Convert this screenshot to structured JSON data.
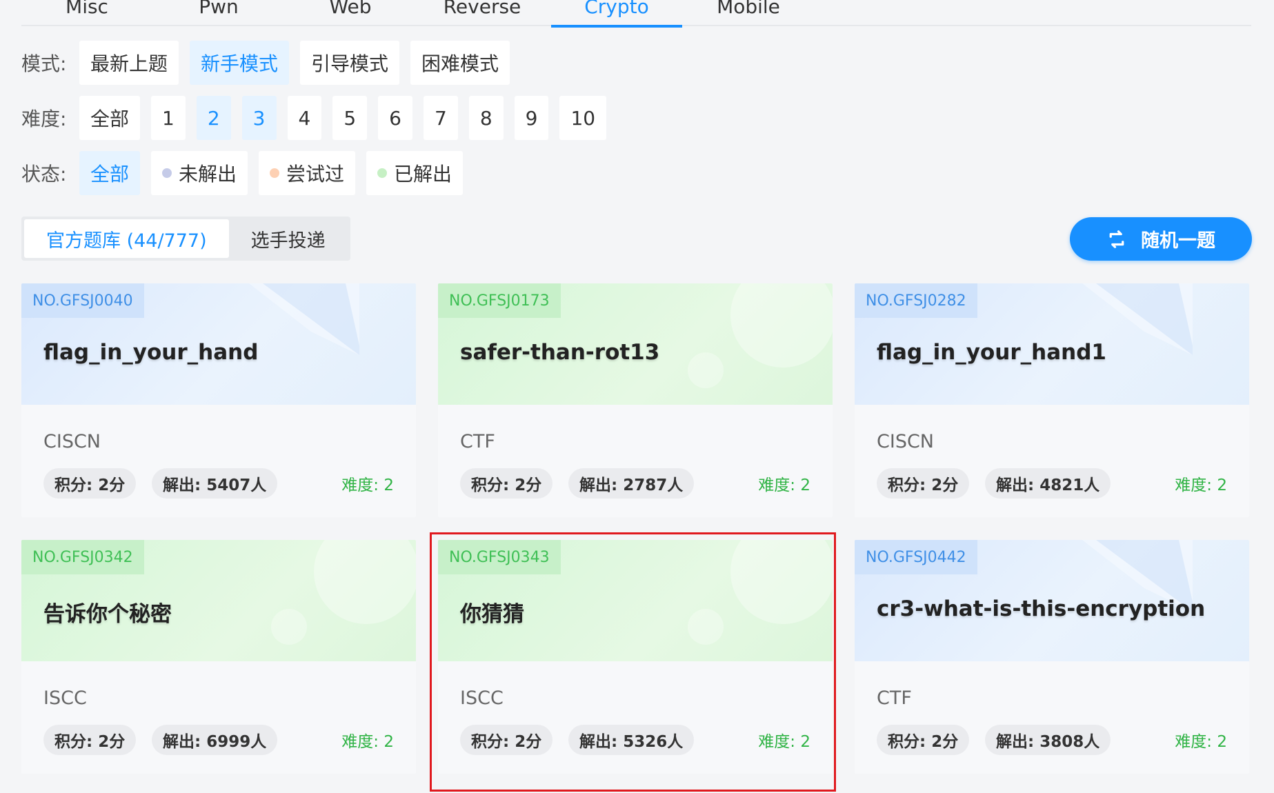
{
  "category_tabs": [
    {
      "label": "Misc",
      "active": false
    },
    {
      "label": "Pwn",
      "active": false
    },
    {
      "label": "Web",
      "active": false
    },
    {
      "label": "Reverse",
      "active": false
    },
    {
      "label": "Crypto",
      "active": true
    },
    {
      "label": "Mobile",
      "active": false
    }
  ],
  "filters": {
    "mode": {
      "label": "模式:",
      "options": [
        {
          "label": "最新上题",
          "active": false
        },
        {
          "label": "新手模式",
          "active": true
        },
        {
          "label": "引导模式",
          "active": false
        },
        {
          "label": "困难模式",
          "active": false
        }
      ]
    },
    "difficulty": {
      "label": "难度:",
      "options": [
        {
          "label": "全部",
          "active": false
        },
        {
          "label": "1",
          "active": false
        },
        {
          "label": "2",
          "active": true
        },
        {
          "label": "3",
          "active": true
        },
        {
          "label": "4",
          "active": false
        },
        {
          "label": "5",
          "active": false
        },
        {
          "label": "6",
          "active": false
        },
        {
          "label": "7",
          "active": false
        },
        {
          "label": "8",
          "active": false
        },
        {
          "label": "9",
          "active": false
        },
        {
          "label": "10",
          "active": false
        }
      ]
    },
    "status": {
      "label": "状态:",
      "options": [
        {
          "label": "全部",
          "active": true,
          "dot": null
        },
        {
          "label": "未解出",
          "active": false,
          "dot": "#c5cbe8"
        },
        {
          "label": "尝试过",
          "active": false,
          "dot": "#fdd0b3"
        },
        {
          "label": "已解出",
          "active": false,
          "dot": "#c6f0c4"
        }
      ]
    }
  },
  "source_tabs": [
    {
      "label": "官方题库 (44/777)",
      "active": true
    },
    {
      "label": "选手投递",
      "active": false
    }
  ],
  "random_button": {
    "label": "随机一题",
    "icon": "refresh-icon"
  },
  "cards": [
    {
      "no": "NO.GFSJ0040",
      "title": "flag_in_your_hand",
      "org": "CISCN",
      "score": "积分: 2分",
      "solves": "解出: 5407人",
      "difficulty": "难度: 2",
      "theme": "blue",
      "highlighted": false
    },
    {
      "no": "NO.GFSJ0173",
      "title": "safer-than-rot13",
      "org": "CTF",
      "score": "积分: 2分",
      "solves": "解出: 2787人",
      "difficulty": "难度: 2",
      "theme": "green",
      "highlighted": false
    },
    {
      "no": "NO.GFSJ0282",
      "title": "flag_in_your_hand1",
      "org": "CISCN",
      "score": "积分: 2分",
      "solves": "解出: 4821人",
      "difficulty": "难度: 2",
      "theme": "blue",
      "highlighted": false
    },
    {
      "no": "NO.GFSJ0342",
      "title": "告诉你个秘密",
      "org": "ISCC",
      "score": "积分: 2分",
      "solves": "解出: 6999人",
      "difficulty": "难度: 2",
      "theme": "green",
      "highlighted": false
    },
    {
      "no": "NO.GFSJ0343",
      "title": "你猜猜",
      "org": "ISCC",
      "score": "积分: 2分",
      "solves": "解出: 5326人",
      "difficulty": "难度: 2",
      "theme": "green",
      "highlighted": true
    },
    {
      "no": "NO.GFSJ0442",
      "title": "cr3-what-is-this-encryption",
      "org": "CTF",
      "score": "积分: 2分",
      "solves": "解出: 3808人",
      "difficulty": "难度: 2",
      "theme": "blue",
      "highlighted": false
    }
  ],
  "colors": {
    "accent": "#1890ff",
    "highlight": "#e0191e",
    "difficulty": "#2fb344"
  }
}
